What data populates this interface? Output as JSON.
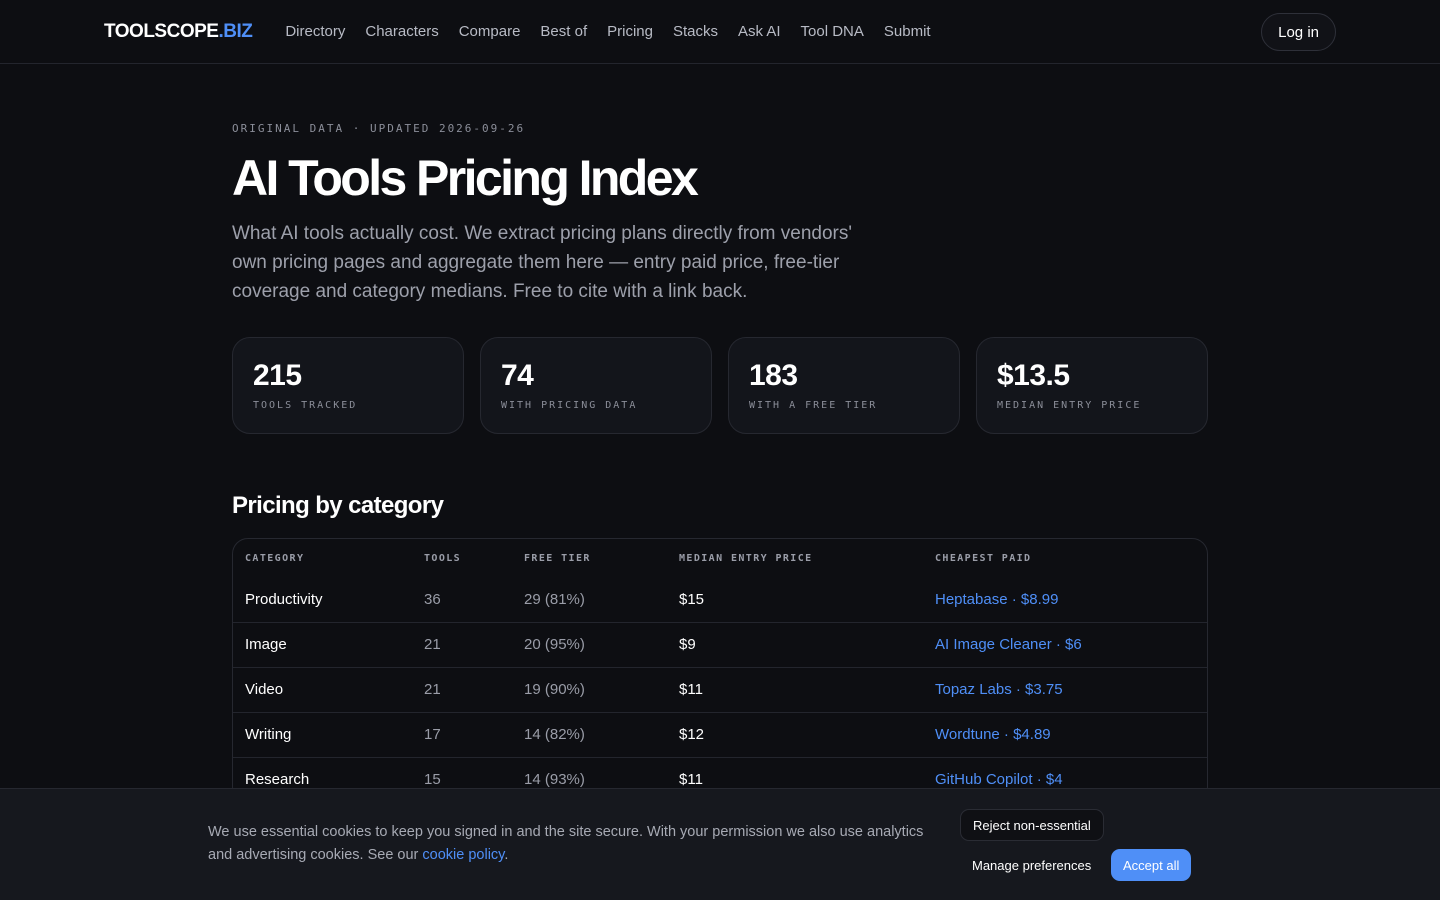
{
  "header": {
    "logo_main": "TOOLSCOPE",
    "logo_accent": ".BIZ",
    "nav": [
      "Directory",
      "Characters",
      "Compare",
      "Best of",
      "Pricing",
      "Stacks",
      "Ask AI",
      "Tool DNA",
      "Submit"
    ],
    "login_label": "Log in"
  },
  "hero": {
    "eyebrow": "ORIGINAL DATA · UPDATED 2026-09-26",
    "title": "AI Tools Pricing Index",
    "lead": "What AI tools actually cost. We extract pricing plans directly from vendors' own pricing pages and aggregate them here — entry paid price, free-tier coverage and category medians. Free to cite with a link back."
  },
  "stats": [
    {
      "value": "215",
      "label": "TOOLS TRACKED"
    },
    {
      "value": "74",
      "label": "WITH PRICING DATA"
    },
    {
      "value": "183",
      "label": "WITH A FREE TIER"
    },
    {
      "value": "$13.5",
      "label": "MEDIAN ENTRY PRICE"
    }
  ],
  "table": {
    "section_title": "Pricing by category",
    "columns": [
      "CATEGORY",
      "TOOLS",
      "FREE TIER",
      "MEDIAN ENTRY PRICE",
      "CHEAPEST PAID"
    ],
    "rows": [
      {
        "category": "Productivity",
        "tools": "36",
        "free_tier": "29 (81%)",
        "median": "$15",
        "cheapest": "Heptabase · $8.99"
      },
      {
        "category": "Image",
        "tools": "21",
        "free_tier": "20 (95%)",
        "median": "$9",
        "cheapest": "AI Image Cleaner · $6"
      },
      {
        "category": "Video",
        "tools": "21",
        "free_tier": "19 (90%)",
        "median": "$11",
        "cheapest": "Topaz Labs · $3.75"
      },
      {
        "category": "Writing",
        "tools": "17",
        "free_tier": "14 (82%)",
        "median": "$12",
        "cheapest": "Wordtune · $4.89"
      },
      {
        "category": "Research",
        "tools": "15",
        "free_tier": "14 (93%)",
        "median": "$11",
        "cheapest": "GitHub Copilot · $4"
      }
    ]
  },
  "cookie": {
    "text_before": "We use essential cookies to keep you signed in and the site secure. With your permission we also use analytics and advertising cookies. See our ",
    "link": "cookie policy",
    "text_after": ".",
    "reject_label": "Reject non-essential",
    "manage_label": "Manage preferences",
    "accept_label": "Accept all"
  },
  "colors": {
    "accent": "#4f8ff7",
    "background": "#0d0e12",
    "card": "#13151b"
  }
}
